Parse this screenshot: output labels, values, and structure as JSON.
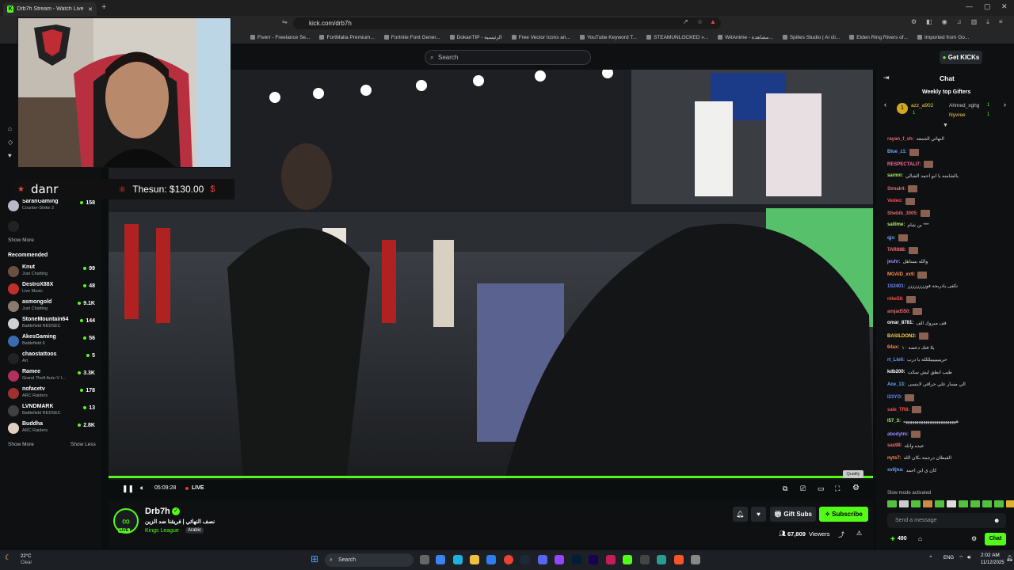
{
  "browser": {
    "tab_title": "Drb7h Stream - Watch Live o",
    "url": "kick.com/drb7h",
    "bookmarks": [
      "Fiverr - Freelance Se...",
      "FortMalia Premium...",
      "Fortnite Font Gener...",
      "DokanTIP - الرئيسية",
      "Free Vector Icons an...",
      "YouTube Keyword T...",
      "STEAMUNLOCKED »...",
      "WitAnime - مشاهدة...",
      "Spilies Studio | Ai cli...",
      "Elden Ring Rivers of...",
      "Imported from Go..."
    ]
  },
  "topbar": {
    "search_placeholder": "Search",
    "get_kicks": "Get KICKs"
  },
  "sidebar": {
    "partial_items": [
      {
        "name": "SarahGaming",
        "game": "Counter-Strike 2",
        "viewers": "158"
      }
    ],
    "show_more_1": "Show More",
    "recommended_title": "Recommended",
    "recommended": [
      {
        "name": "Knut",
        "game": "Just Chatting",
        "viewers": "99"
      },
      {
        "name": "DestroX88X",
        "game": "Live Music",
        "viewers": "48"
      },
      {
        "name": "asmongold",
        "game": "Just Chatting",
        "viewers": "9.1K"
      },
      {
        "name": "StoneMountain64",
        "game": "Battlefield REDSEC",
        "viewers": "144"
      },
      {
        "name": "AkesGaming",
        "game": "Battlefield 6",
        "viewers": "56"
      },
      {
        "name": "chaostattoos",
        "game": "Art",
        "viewers": "5"
      },
      {
        "name": "Ramee",
        "game": "Grand Theft Auto V I...",
        "viewers": "3.3K"
      },
      {
        "name": "nofacetv",
        "game": "ARC Raiders",
        "viewers": "178"
      },
      {
        "name": "LVNDMARK",
        "game": "Battlefield REDSEC",
        "viewers": "13"
      },
      {
        "name": "Buddha",
        "game": "ARC Raiders",
        "viewers": "2.8K"
      }
    ],
    "show_more_2": "Show More",
    "show_less": "Show Less"
  },
  "overlay": {
    "donor": "danr",
    "donation": "Thesun: $130.00"
  },
  "player": {
    "time": "05:09:28",
    "live": "LIVE",
    "quality": "Quality",
    "progress": 1.0
  },
  "stream": {
    "channel": "Drb7h",
    "title": "نصف النهائي | فريقنا ضد الزين",
    "category": "Kings League",
    "language": "Arabic",
    "viewers": "67,809",
    "viewers_label": "Viewers",
    "gift_subs": "Gift Subs",
    "subscribe": "Subscribe",
    "live_badge": "LIVE"
  },
  "chat": {
    "title": "Chat",
    "gifters_title": "Weekly top Gifters",
    "gifters": [
      {
        "name": "azz_a902",
        "count": "1"
      },
      {
        "name": "Ahmed_xghg",
        "count": "1"
      },
      {
        "name": "Nyvree",
        "count": "1"
      }
    ],
    "messages": [
      {
        "user": "rayan_f_sh:",
        "text": "النهائي الجمعه",
        "color": "#e06b6b"
      },
      {
        "user": "Blue_z1:",
        "text": "",
        "color": "#6ba7ff"
      },
      {
        "user": "RESPECTALI7:",
        "text": "",
        "color": "#ff6b9a"
      },
      {
        "user": "sarmn:",
        "text": "يالشامنه يا ابو احمد الشالي",
        "color": "#aaf06b"
      },
      {
        "user": "Stmak4:",
        "text": "",
        "color": "#e06b6b"
      },
      {
        "user": "Vedeo:",
        "text": "",
        "color": "#ff4f4f"
      },
      {
        "user": "Shebib_3005:",
        "text": "",
        "color": "#e06b6b"
      },
      {
        "user": "salilme:",
        "text": "بن شام ***",
        "color": "#aaf06b"
      },
      {
        "user": "qjx:",
        "text": "",
        "color": "#6ba7ff"
      },
      {
        "user": "TAR888:",
        "text": "",
        "color": "#ff6b6b"
      },
      {
        "user": "jeuhr:",
        "text": "والله بستاهل",
        "color": "#9a8cff"
      },
      {
        "user": "MOAID_xx9:",
        "text": "",
        "color": "#ff8c4f"
      },
      {
        "user": "1S2401:",
        "text": "تكفى يادربحه فوزززززززز",
        "color": "#6b8cff"
      },
      {
        "user": "nike58:",
        "text": "",
        "color": "#ff4f4f"
      },
      {
        "user": "amjad550:",
        "text": "",
        "color": "#e06b6b"
      },
      {
        "user": "omar_8781:",
        "text": "قف مبروك الف",
        "color": "#ffffff"
      },
      {
        "user": "BASILDON2:",
        "text": "",
        "color": "#ffd24f"
      },
      {
        "user": "64ax:",
        "text": "يلا فتك دعصه ١٠",
        "color": "#ff8c4f"
      },
      {
        "user": "rt_Lioli:",
        "text": "حرييييييييلللله يا درب",
        "color": "#6ba7ff"
      },
      {
        "user": "kdb200:",
        "text": "طيب انطق ليش سكت",
        "color": "#ffffff"
      },
      {
        "user": "Ace_13:",
        "text": "الي مسار علي جرافي لاينسى",
        "color": "#6ba7ff"
      },
      {
        "user": "l23YO:",
        "text": "",
        "color": "#6b8cff"
      },
      {
        "user": "sale_TR8:",
        "text": "",
        "color": "#ff4f4f"
      },
      {
        "user": "l57_3:",
        "text": "ههههههههههههههههههههههههه",
        "color": "#aaf06b"
      },
      {
        "user": "abodytm:",
        "text": "",
        "color": "#9a8cff"
      },
      {
        "user": "sas98:",
        "text": "عيده وانله",
        "color": "#ff6b6b"
      },
      {
        "user": "nyts7:",
        "text": "القبطان درجمة بكان الله",
        "color": "#ff8c4f"
      },
      {
        "user": "svlljna:",
        "text": "كان ي اين احمد",
        "color": "#6ba7ff"
      }
    ],
    "slow_mode": "Slow mode activated",
    "input_placeholder": "Send a message",
    "points": "490",
    "chat_button": "Chat"
  },
  "taskbar": {
    "search": "Search",
    "weather_temp": "22°C",
    "weather_desc": "Clear",
    "lang": "ENG",
    "time": "2:02 AM",
    "date": "11/12/2025"
  }
}
